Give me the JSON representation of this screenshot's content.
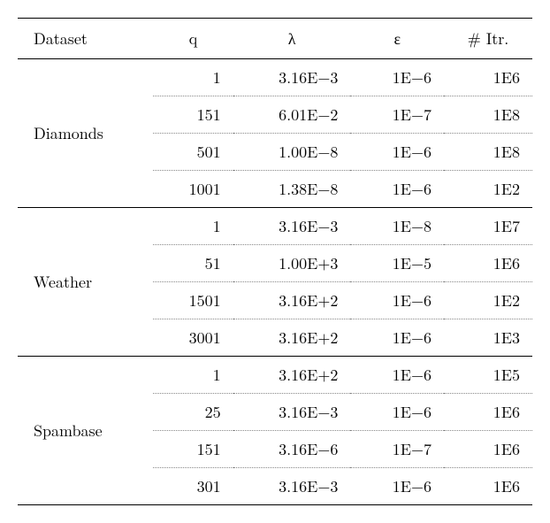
{
  "chart_data": {
    "type": "table",
    "columns": [
      "Dataset",
      "q",
      "λ",
      "ε",
      "# Itr."
    ],
    "groups": [
      {
        "dataset": "Diamonds",
        "rows": [
          {
            "q": "1",
            "lambda": "3.16E−3",
            "eps": "1E−6",
            "itr": "1E6"
          },
          {
            "q": "151",
            "lambda": "6.01E−2",
            "eps": "1E−7",
            "itr": "1E8"
          },
          {
            "q": "501",
            "lambda": "1.00E−8",
            "eps": "1E−6",
            "itr": "1E8"
          },
          {
            "q": "1001",
            "lambda": "1.38E−8",
            "eps": "1E−6",
            "itr": "1E2"
          }
        ]
      },
      {
        "dataset": "Weather",
        "rows": [
          {
            "q": "1",
            "lambda": "3.16E−3",
            "eps": "1E−8",
            "itr": "1E7"
          },
          {
            "q": "51",
            "lambda": "1.00E+3",
            "eps": "1E−5",
            "itr": "1E6"
          },
          {
            "q": "1501",
            "lambda": "3.16E+2",
            "eps": "1E−6",
            "itr": "1E2"
          },
          {
            "q": "3001",
            "lambda": "3.16E+2",
            "eps": "1E−6",
            "itr": "1E3"
          }
        ]
      },
      {
        "dataset": "Spambase",
        "rows": [
          {
            "q": "1",
            "lambda": "3.16E+2",
            "eps": "1E−6",
            "itr": "1E5"
          },
          {
            "q": "25",
            "lambda": "3.16E−3",
            "eps": "1E−6",
            "itr": "1E6"
          },
          {
            "q": "151",
            "lambda": "3.16E−6",
            "eps": "1E−7",
            "itr": "1E6"
          },
          {
            "q": "301",
            "lambda": "3.16E−3",
            "eps": "1E−6",
            "itr": "1E6"
          }
        ]
      }
    ]
  }
}
